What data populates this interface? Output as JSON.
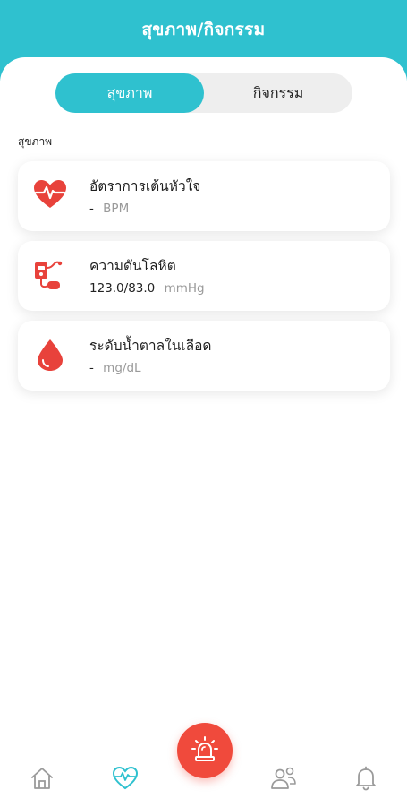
{
  "header": {
    "title": "สุขภาพ/กิจกรรม"
  },
  "tabs": [
    {
      "label": "สุขภาพ",
      "active": true
    },
    {
      "label": "กิจกรรม",
      "active": false
    }
  ],
  "section": {
    "label": "สุขภาพ"
  },
  "cards": [
    {
      "title": "อัตราการเต้นหัวใจ",
      "value": "-",
      "unit": "BPM",
      "icon": "heart-rate-icon"
    },
    {
      "title": "ความดันโลหิต",
      "value": "123.0/83.0",
      "unit": "mmHg",
      "icon": "blood-pressure-icon"
    },
    {
      "title": "ระดับน้ำตาลในเลือด",
      "value": "-",
      "unit": "mg/dL",
      "icon": "blood-drop-icon"
    }
  ],
  "bottom_nav": {
    "items": [
      {
        "icon": "home-icon",
        "active": false
      },
      {
        "icon": "heart-pulse-icon",
        "active": true
      },
      {
        "icon": "users-icon",
        "active": false
      },
      {
        "icon": "bell-icon",
        "active": false
      }
    ],
    "center_button_icon": "siren-icon"
  },
  "colors": {
    "accent": "#2fc1cf",
    "danger": "#f04a3c",
    "muted": "#9a9a9a"
  }
}
